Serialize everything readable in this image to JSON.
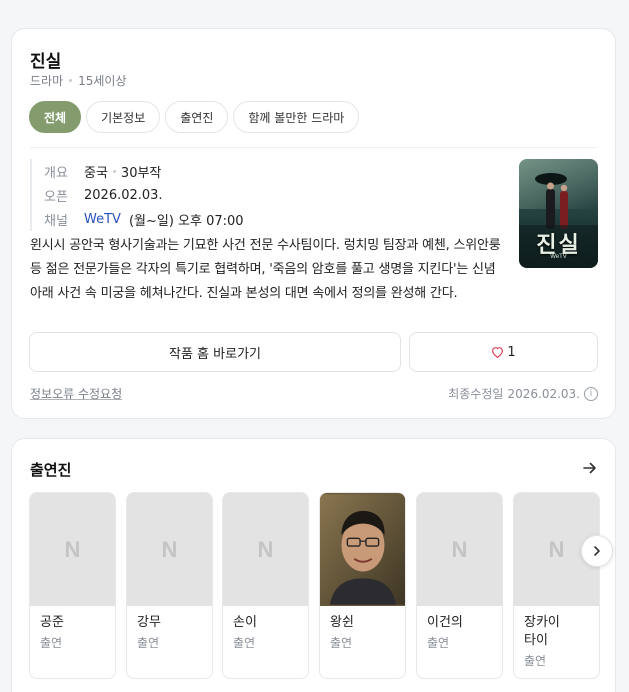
{
  "drama": {
    "title": "진실",
    "genre": "드라마",
    "rating": "15세이상"
  },
  "tabs": [
    {
      "label": "전체",
      "active": true
    },
    {
      "label": "기본정보",
      "active": false
    },
    {
      "label": "출연진",
      "active": false
    },
    {
      "label": "함께 볼만한 드라마",
      "active": false
    }
  ],
  "overview": {
    "label": "개요",
    "country": "중국",
    "episodes": "30부작"
  },
  "open": {
    "label": "오픈",
    "date": "2026.02.03."
  },
  "channel": {
    "label": "채널",
    "name": "WeTV",
    "schedule": "(월~일) 오후 07:00"
  },
  "description": "윈시시 공안국 형사기술과는 기묘한 사건 전문 수사팀이다. 렁치밍 팀장과 예첸, 스위안룽 등 젊은 전문가들은 각자의 특기로 협력하며, '죽음의 암호를 풀고 생명을 지킨다'는 신념 아래 사건 속 미궁을 헤쳐나간다. 진실과 본성의 대면 속에서 정의를 완성해 간다.",
  "poster": {
    "title_text": "진실",
    "logo_text": "WeTV"
  },
  "actions": {
    "home_label": "작품 홈 바로가기",
    "like_count": "1"
  },
  "footer": {
    "report_label": "정보오류 수정요청",
    "updated_label": "최종수정일",
    "updated_date": "2026.02.03."
  },
  "cast": {
    "title": "출연진",
    "placeholder_letter": "N",
    "members": [
      {
        "name": "공준",
        "role": "출연",
        "has_photo": false
      },
      {
        "name": "강무",
        "role": "출연",
        "has_photo": false
      },
      {
        "name": "손이",
        "role": "출연",
        "has_photo": false
      },
      {
        "name": "왕쉰",
        "role": "출연",
        "has_photo": true
      },
      {
        "name": "이건의",
        "role": "출연",
        "has_photo": false
      },
      {
        "name": "장카이타이",
        "role": "출연",
        "has_photo": false
      }
    ]
  },
  "colors": {
    "tab_active": "#849c6d",
    "link": "#2a52be",
    "heart": "#e0445a"
  }
}
